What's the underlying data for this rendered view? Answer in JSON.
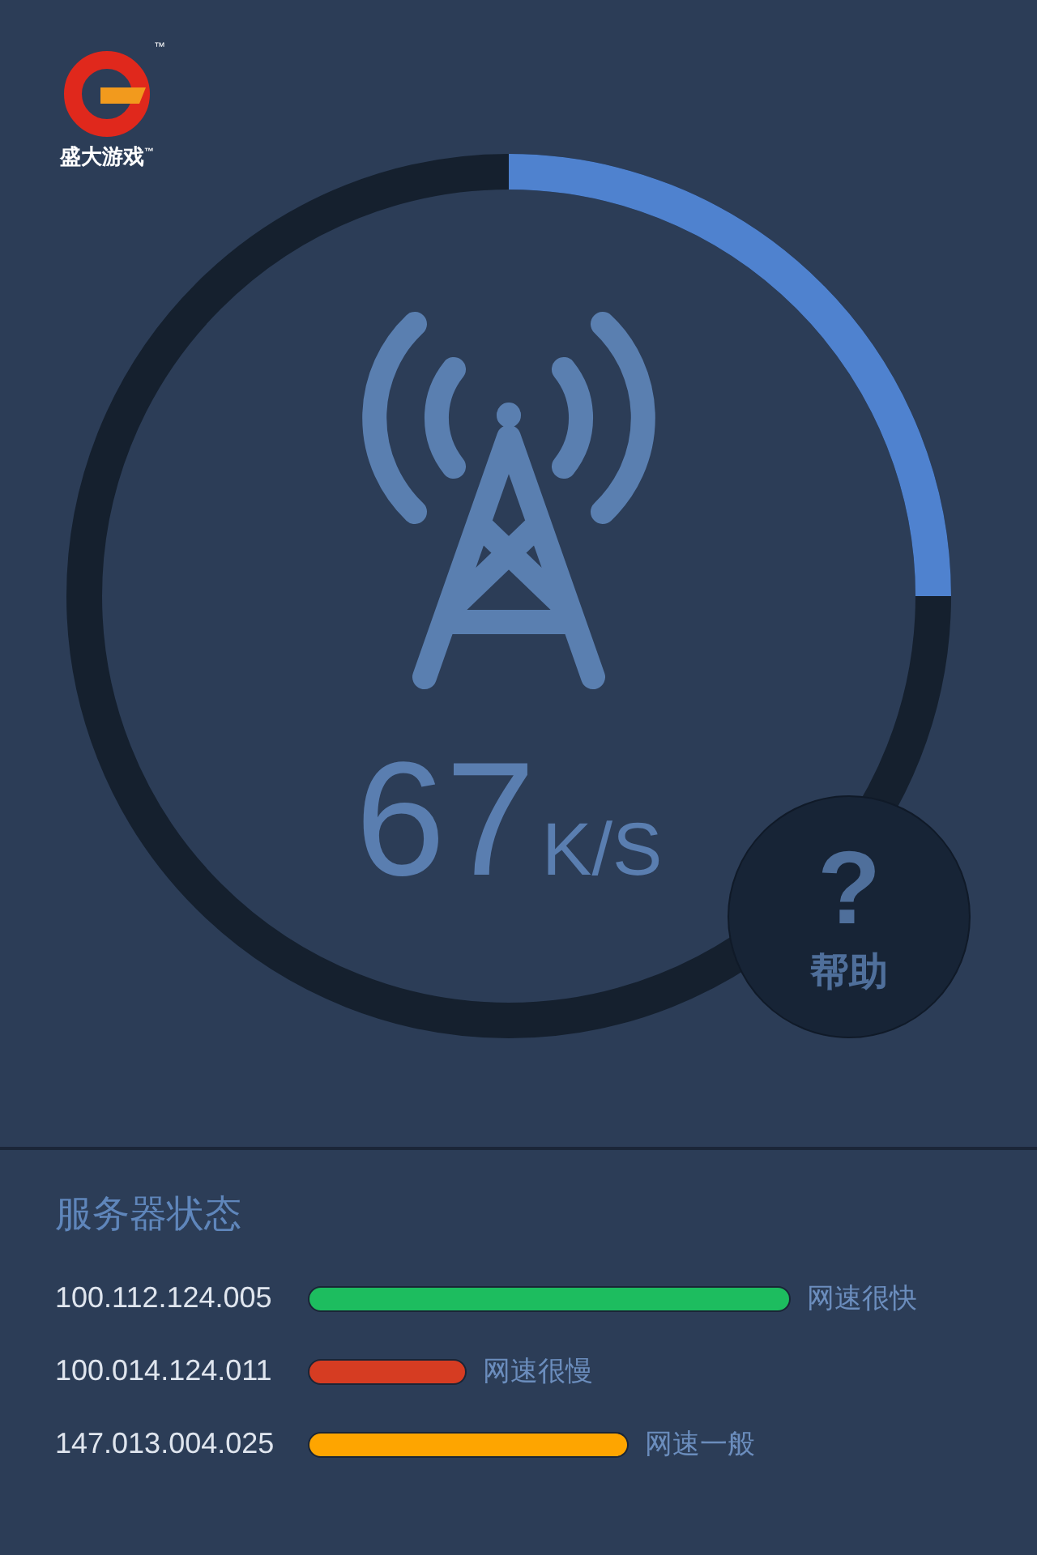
{
  "logo": {
    "icon_mark": "™",
    "text": "盛大游戏",
    "text_mark": "™"
  },
  "speed": {
    "value": "67",
    "unit": "K/S"
  },
  "help": {
    "icon": "?",
    "label": "帮助"
  },
  "server_status": {
    "title": "服务器状态",
    "servers": [
      {
        "ip": "100.112.124.005",
        "color": "#1dbd5f",
        "status": "网速很快"
      },
      {
        "ip": "100.014.124.011",
        "color": "#d63c22",
        "status": "网速很慢"
      },
      {
        "ip": "147.013.004.025",
        "color": "#fea500",
        "status": "网速一般"
      }
    ]
  }
}
